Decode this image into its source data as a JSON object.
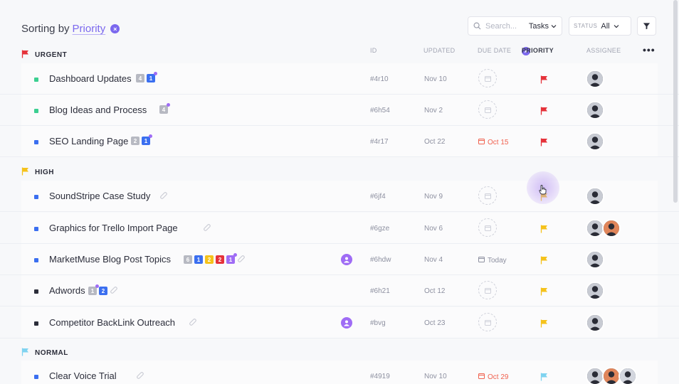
{
  "header": {
    "sort_prefix": "Sorting by",
    "sort_field": "Priority",
    "clear_glyph": "×"
  },
  "search": {
    "placeholder": "Search...",
    "scope": "Tasks"
  },
  "status_filter": {
    "label": "STATUS",
    "value": "All"
  },
  "columns": {
    "id": "ID",
    "updated": "UPDATED",
    "due_date": "DUE DATE",
    "priority": "PRIORITY",
    "assignee": "ASSIGNEE"
  },
  "colors": {
    "accent": "#7b68ee",
    "urgent": "#e5323a",
    "high": "#f5c21b",
    "normal": "#7fd3f0",
    "overdue": "#f0614f"
  },
  "icons": {
    "search": "search-icon",
    "chevron": "chevron-down-icon",
    "filter": "filter-icon",
    "more": "more-icon",
    "flag": "flag-icon",
    "calendar": "calendar-icon",
    "attachment": "paperclip-icon",
    "avatar": "avatar-icon"
  },
  "groups": [
    {
      "label": "URGENT",
      "tasks": [
        {
          "name": "Dashboard Updates",
          "chips": [
            "4",
            "1"
          ],
          "id": "#4r10",
          "updated": "Nov 10",
          "due": "",
          "bullet": "#3ccf91"
        },
        {
          "name": "Blog Ideas and Process",
          "chips": [
            "4"
          ],
          "id": "#6h54",
          "updated": "Nov 2",
          "due": "",
          "bullet": "#3ccf91"
        },
        {
          "name": "SEO Landing Page",
          "chips": [
            "2",
            "1"
          ],
          "id": "#4r17",
          "updated": "Oct 22",
          "due": "Oct 15",
          "bullet": "#3b6ff0"
        }
      ]
    },
    {
      "label": "HIGH",
      "tasks": [
        {
          "name": "SoundStripe Case Study",
          "chips": [],
          "id": "#6jf4",
          "updated": "Nov 9",
          "due": "",
          "bullet": "#3b6ff0"
        },
        {
          "name": "Graphics for Trello Import Page",
          "chips": [],
          "id": "#6gze",
          "updated": "Nov 6",
          "due": "",
          "bullet": "#3b6ff0"
        },
        {
          "name": "MarketMuse Blog Post Topics",
          "chips": [
            "6",
            "1",
            "2",
            "2",
            "1"
          ],
          "id": "#6hdw",
          "updated": "Nov 4",
          "due": "Today",
          "bullet": "#3b6ff0"
        },
        {
          "name": "Adwords",
          "chips": [
            "1",
            "2"
          ],
          "id": "#6h21",
          "updated": "Oct 12",
          "due": "",
          "bullet": "#2b2d3a"
        },
        {
          "name": "Competitor BackLink Outreach",
          "chips": [],
          "id": "#bvg",
          "updated": "Oct 23",
          "due": "",
          "bullet": "#2b2d3a"
        }
      ]
    },
    {
      "label": "NORMAL",
      "tasks": [
        {
          "name": "Clear Voice Trial",
          "chips": [],
          "id": "#4919",
          "updated": "Nov 10",
          "due": "Oct 29",
          "bullet": "#3b6ff0"
        }
      ]
    }
  ]
}
